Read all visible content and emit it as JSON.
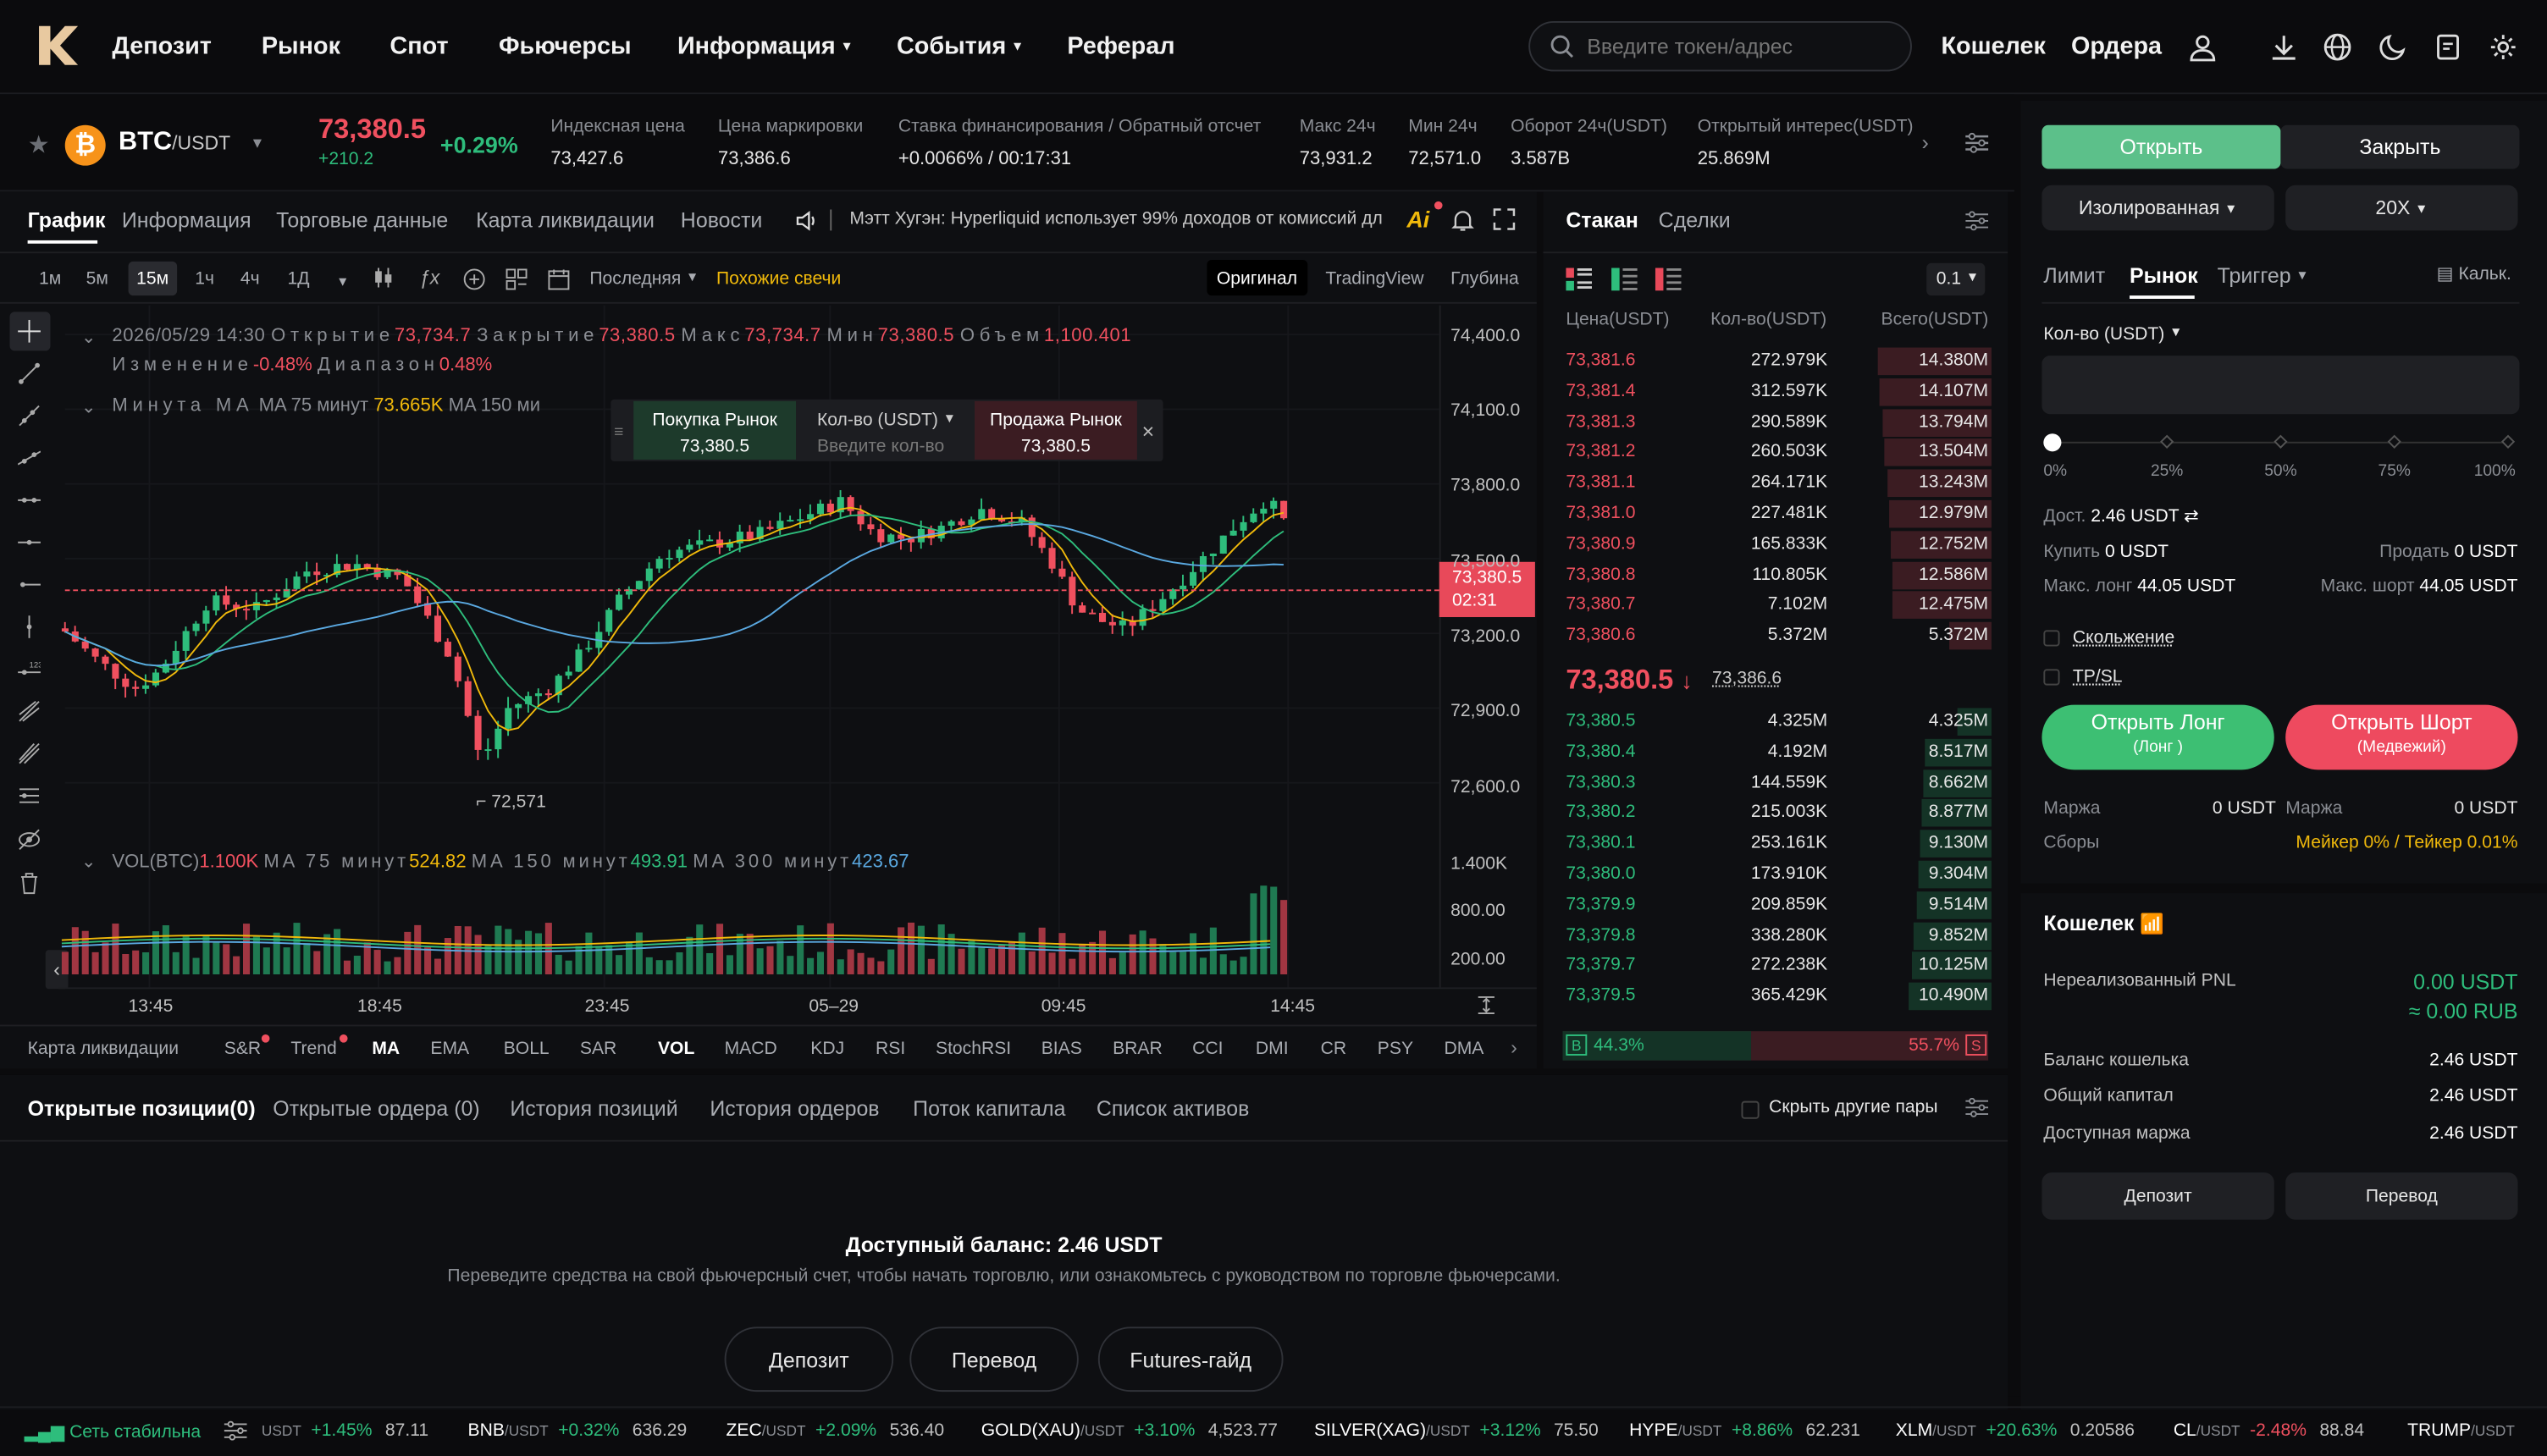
{
  "nav": {
    "items": [
      "Депозит",
      "Рынок",
      "Спот",
      "Фьючерсы",
      "Информация",
      "События",
      "Реферал"
    ],
    "search_placeholder": "Введите токен/адрес",
    "wallet": "Кошелек",
    "orders": "Ордера"
  },
  "ticker": {
    "symbol": "BTC",
    "quote": "/USDT",
    "price": "73,380.5",
    "change_abs": "+210.2",
    "change_pct": "+0.29%",
    "stats": [
      {
        "label": "Индексная цена",
        "value": "73,427.6"
      },
      {
        "label": "Цена маркировки",
        "value": "73,386.6"
      },
      {
        "label": "Ставка финансирования / Обратный отсчет",
        "value": "+0.0066% / 00:17:31"
      },
      {
        "label": "Макс 24ч",
        "value": "73,931.2"
      },
      {
        "label": "Мин 24ч",
        "value": "72,571.0"
      },
      {
        "label": "Оборот 24ч(USDT)",
        "value": "3.587B"
      },
      {
        "label": "Открытый интерес(USDT)",
        "value": "25.869M"
      }
    ]
  },
  "chart_tabs": [
    "График",
    "Информация",
    "Торговые данные",
    "Карта ликвидации",
    "Новости"
  ],
  "news_ticker": "Мэтт Хугэн: Hyperliquid использует 99% доходов от комиссий дл",
  "timeframes": [
    "1м",
    "5м",
    "15м",
    "1ч",
    "4ч",
    "1Д"
  ],
  "chart_toolbar": {
    "price_type": "Последняя",
    "similar": "Похожие свечи",
    "views": [
      "Оригинал",
      "TradingView",
      "Глубина"
    ]
  },
  "ohlc": {
    "date": "2026/05/29 14:30",
    "open_label": "Открытие",
    "open": "73,734.7",
    "close_label": "Закрытие",
    "close": "73,380.5",
    "high_label": "Макс",
    "high": "73,734.7",
    "low_label": "Мин",
    "low": "73,380.5",
    "vol_label": "Объем",
    "vol": "1,100.401",
    "chg_label": "Изменение",
    "chg": "-0.48%",
    "range_label": "Диапазон",
    "range": "0.48%"
  },
  "ma_legend": {
    "text": "Минута MA",
    "ma75_label": "MA 75 минут",
    "ma75": "73.665K",
    "ma150_label": "MA 150 ми"
  },
  "quick_trade": {
    "buy": "Покупка Рынок",
    "buy_price": "73,380.5",
    "qty": "Кол-во (USDT)",
    "qty_placeholder": "Введите кол-во",
    "sell": "Продажа Рынок",
    "sell_price": "73,380.5"
  },
  "price_axis": [
    "74,400.0",
    "74,100.0",
    "73,800.0",
    "73,500.0",
    "73,200.0",
    "72,900.0",
    "72,600.0"
  ],
  "current_price_tag": {
    "price": "73,380.5",
    "countdown": "02:31"
  },
  "low_marker": "72,571",
  "vol_legend": {
    "label": "VOL(BTC)",
    "vol": "1.100K",
    "ma75_label": "MA 75 минут",
    "ma75": "524.82",
    "ma150_label": "MA 150 минут",
    "ma150": "493.91",
    "ma300_label": "MA 300 минут",
    "ma300": "423.67"
  },
  "vol_axis": [
    "1.400K",
    "800.00",
    "200.00"
  ],
  "time_axis": [
    "13:45",
    "18:45",
    "23:45",
    "05–29",
    "09:45",
    "14:45"
  ],
  "indicators": [
    "Карта ликвидации",
    "S&R",
    "Trend",
    "MA",
    "EMA",
    "BOLL",
    "SAR",
    "VOL",
    "MACD",
    "KDJ",
    "RSI",
    "StochRSI",
    "BIAS",
    "BRAR",
    "CCI",
    "DMI",
    "CR",
    "PSY",
    "DMA"
  ],
  "orderbook": {
    "tabs": [
      "Стакан",
      "Сделки"
    ],
    "precision": "0.1",
    "headers": [
      "Цена(USDT)",
      "Кол-во(USDT)",
      "Всего(USDT)"
    ],
    "asks": [
      [
        "73,381.6",
        "272.979K",
        "14.380M"
      ],
      [
        "73,381.4",
        "312.597K",
        "14.107M"
      ],
      [
        "73,381.3",
        "290.589K",
        "13.794M"
      ],
      [
        "73,381.2",
        "260.503K",
        "13.504M"
      ],
      [
        "73,381.1",
        "264.171K",
        "13.243M"
      ],
      [
        "73,381.0",
        "227.481K",
        "12.979M"
      ],
      [
        "73,380.9",
        "165.833K",
        "12.752M"
      ],
      [
        "73,380.8",
        "110.805K",
        "12.586M"
      ],
      [
        "73,380.7",
        "7.102M",
        "12.475M"
      ],
      [
        "73,380.6",
        "5.372M",
        "5.372M"
      ]
    ],
    "mid_price": "73,380.5",
    "mid_mark": "73,386.6",
    "bids": [
      [
        "73,380.5",
        "4.325M",
        "4.325M"
      ],
      [
        "73,380.4",
        "4.192M",
        "8.517M"
      ],
      [
        "73,380.3",
        "144.559K",
        "8.662M"
      ],
      [
        "73,380.2",
        "215.003K",
        "8.877M"
      ],
      [
        "73,380.1",
        "253.161K",
        "9.130M"
      ],
      [
        "73,380.0",
        "173.910K",
        "9.304M"
      ],
      [
        "73,379.9",
        "209.859K",
        "9.514M"
      ],
      [
        "73,379.8",
        "338.280K",
        "9.852M"
      ],
      [
        "73,379.7",
        "272.238K",
        "10.125M"
      ],
      [
        "73,379.5",
        "365.429K",
        "10.490M"
      ]
    ],
    "buy_pct": "44.3%",
    "sell_pct": "55.7%",
    "b": "B",
    "s": "S"
  },
  "trade": {
    "open": "Открыть",
    "close": "Закрыть",
    "margin_mode": "Изолированная",
    "leverage": "20X",
    "types": [
      "Лимит",
      "Рынок",
      "Триггер"
    ],
    "calc": "Кальк.",
    "qty_label": "Кол-во (USDT)",
    "slider": [
      "0%",
      "25%",
      "50%",
      "75%",
      "100%"
    ],
    "avail_label": "Дост.",
    "avail": "2.46 USDT",
    "buy_label": "Купить",
    "buy": "0 USDT",
    "sell_label": "Продать",
    "sell": "0 USDT",
    "max_long_label": "Макс. лонг",
    "max_long": "44.05 USDT",
    "max_short_label": "Макс. шорт",
    "max_short": "44.05 USDT",
    "slippage": "Скольжение",
    "tpsl": "TP/SL",
    "long_btn": "Открыть Лонг",
    "long_sub": "(Лонг )",
    "short_btn": "Открыть Шорт",
    "short_sub": "(Медвежий)",
    "margin_label": "Маржа",
    "margin_l": "0 USDT",
    "margin_r": "0 USDT",
    "fees_label": "Сборы",
    "fees": "Мейкер 0% / Тейкер 0.01%"
  },
  "wallet": {
    "title": "Кошелек",
    "upnl_label": "Нереализованный PNL",
    "upnl": "0.00 USDT",
    "upnl_rub": "≈ 0.00 RUB",
    "rows": [
      {
        "label": "Баланс кошелька",
        "value": "2.46 USDT"
      },
      {
        "label": "Общий капитал",
        "value": "2.46 USDT"
      },
      {
        "label": "Доступная маржа",
        "value": "2.46 USDT"
      }
    ],
    "deposit": "Депозит",
    "transfer": "Перевод"
  },
  "positions": {
    "tabs": [
      "Открытые позиции(0)",
      "Открытые ордера (0)",
      "История позиций",
      "История ордеров",
      "Поток капитала",
      "Список активов"
    ],
    "hide_pairs": "Скрыть другие пары",
    "balance": "Доступный баланс: 2.46 USDT",
    "hint": "Переведите средства на свой фьючерсный счет, чтобы начать торговлю, или ознакомьтесь с руководством по торговле фьючерсами.",
    "buttons": [
      "Депозит",
      "Перевод",
      "Futures-гайд"
    ]
  },
  "footer": {
    "status": "Сеть стабильна",
    "items": [
      {
        "sym": "",
        "q": "USDT",
        "chg": "+1.45%",
        "price": "87.11",
        "up": true
      },
      {
        "sym": "BNB",
        "q": "/USDT",
        "chg": "+0.32%",
        "price": "636.29",
        "up": true
      },
      {
        "sym": "ZEC",
        "q": "/USDT",
        "chg": "+2.09%",
        "price": "536.40",
        "up": true
      },
      {
        "sym": "GOLD(XAU)",
        "q": "/USDT",
        "chg": "+3.10%",
        "price": "4,523.77",
        "up": true
      },
      {
        "sym": "SILVER(XAG)",
        "q": "/USDT",
        "chg": "+3.12%",
        "price": "75.50",
        "up": true
      },
      {
        "sym": "HYPE",
        "q": "/USDT",
        "chg": "+8.86%",
        "price": "62.231",
        "up": true
      },
      {
        "sym": "XLM",
        "q": "/USDT",
        "chg": "+20.63%",
        "price": "0.20586",
        "up": true
      },
      {
        "sym": "CL",
        "q": "/USDT",
        "chg": "-2.48%",
        "price": "88.84",
        "up": false
      },
      {
        "sym": "TRUMP",
        "q": "/USDT",
        "chg": "",
        "price": "",
        "up": true
      }
    ]
  },
  "colors": {
    "green": "#2ebd7c",
    "red": "#f0505f",
    "accent_green": "#3dbf73",
    "yellow": "#f0b90b"
  }
}
